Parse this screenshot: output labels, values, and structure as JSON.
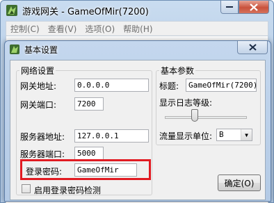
{
  "main_window": {
    "title": "游戏网关 - GameOfMir(7200)",
    "menu": [
      "控制(C)",
      "查看(V)",
      "选项(O)",
      "帮助(H)"
    ]
  },
  "dialog": {
    "title": "基本设置",
    "network_group": {
      "legend": "网络设置",
      "gateway_address": {
        "label": "网关地址:",
        "value": "0.0.0.0"
      },
      "gateway_port": {
        "label": "网关端口:",
        "value": "7200"
      },
      "server_address": {
        "label": "服务器地址:",
        "value": "127.0.0.1"
      },
      "server_port": {
        "label": "服务器端口:",
        "value": "5000"
      },
      "login_password": {
        "label": "登录密码:",
        "value": "GameOfMir"
      },
      "enable_password_check": {
        "label": "启用登录密码检测",
        "checked": false
      }
    },
    "basic_group": {
      "legend": "基本参数",
      "title_field": {
        "label": "标题:",
        "value": "GameOfMir(7200)"
      },
      "log_level": {
        "label": "显示日志等级:",
        "level": 0.35
      },
      "traffic_unit": {
        "label": "流量显示单位:",
        "value": "B"
      }
    },
    "ok_button": "确定(O)"
  },
  "colors": {
    "highlight": "#e11b22",
    "title_bar": "#b9cfe8"
  }
}
